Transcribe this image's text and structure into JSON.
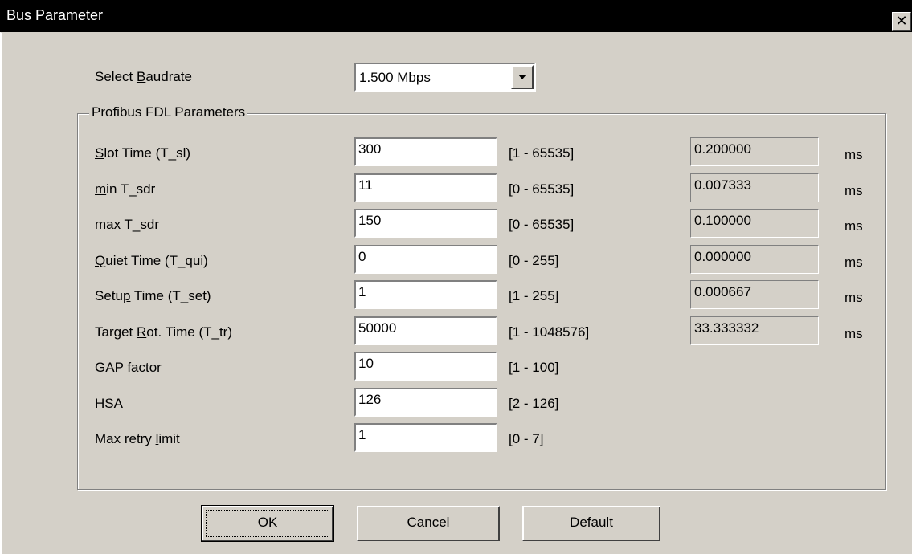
{
  "window": {
    "title": "Bus Parameter",
    "close_glyph": "✕"
  },
  "baudrate": {
    "label_pre": "Select ",
    "label_key": "B",
    "label_post": "audrate",
    "selected": "1.500 Mbps"
  },
  "group": {
    "title": "Profibus FDL Parameters"
  },
  "params": [
    {
      "pre": "",
      "key": "S",
      "post": "lot Time (T_sl)",
      "value": "300",
      "range": "[1 - 65535]",
      "computed": "0.200000",
      "unit": "ms"
    },
    {
      "pre": "",
      "key": "m",
      "post": "in T_sdr",
      "value": "11",
      "range": "[0 - 65535]",
      "computed": "0.007333",
      "unit": "ms"
    },
    {
      "pre": "ma",
      "key": "x",
      "post": " T_sdr",
      "value": "150",
      "range": "[0 - 65535]",
      "computed": "0.100000",
      "unit": "ms"
    },
    {
      "pre": "",
      "key": "Q",
      "post": "uiet Time (T_qui)",
      "value": "0",
      "range": "[0 - 255]",
      "computed": "0.000000",
      "unit": "ms"
    },
    {
      "pre": "Setu",
      "key": "p",
      "post": " Time (T_set)",
      "value": "1",
      "range": "[1 - 255]",
      "computed": "0.000667",
      "unit": "ms"
    },
    {
      "pre": "Target ",
      "key": "R",
      "post": "ot. Time (T_tr)",
      "value": "50000",
      "range": "[1 - 1048576]",
      "computed": "33.333332",
      "unit": "ms"
    },
    {
      "pre": "",
      "key": "G",
      "post": "AP factor",
      "value": "10",
      "range": "[1 - 100]"
    },
    {
      "pre": "",
      "key": "H",
      "post": "SA",
      "value": "126",
      "range": "[2 - 126]"
    },
    {
      "pre": "Max retry ",
      "key": "l",
      "post": "imit",
      "value": "1",
      "range": "[0 - 7]"
    }
  ],
  "buttons": {
    "ok": "OK",
    "cancel": "Cancel",
    "default_pre": "De",
    "default_key": "f",
    "default_post": "ault"
  }
}
